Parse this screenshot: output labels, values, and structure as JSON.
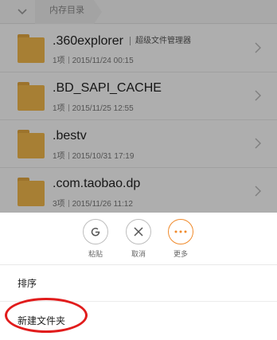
{
  "breadcrumb": {
    "current": "内存目录"
  },
  "files": [
    {
      "name": ".360explorer",
      "tag": "超级文件管理器",
      "count": "1项",
      "date": "2015/11/24 00:15"
    },
    {
      "name": ".BD_SAPI_CACHE",
      "tag": "",
      "count": "1项",
      "date": "2015/11/25 12:55"
    },
    {
      "name": ".bestv",
      "tag": "",
      "count": "1项",
      "date": "2015/10/31 17:19"
    },
    {
      "name": ".com.taobao.dp",
      "tag": "",
      "count": "3项",
      "date": "2015/11/26 11:12"
    }
  ],
  "actions": {
    "paste": {
      "label": "粘贴",
      "icon": "paste-icon"
    },
    "cancel": {
      "label": "取消",
      "icon": "close-icon"
    },
    "more": {
      "label": "更多",
      "icon": "more-dots-icon"
    }
  },
  "menu": {
    "sort": "排序",
    "new_folder": "新建文件夹"
  },
  "colors": {
    "folder": "#f0b64b",
    "accent": "#f08a2b",
    "highlight": "#e11c1c"
  }
}
